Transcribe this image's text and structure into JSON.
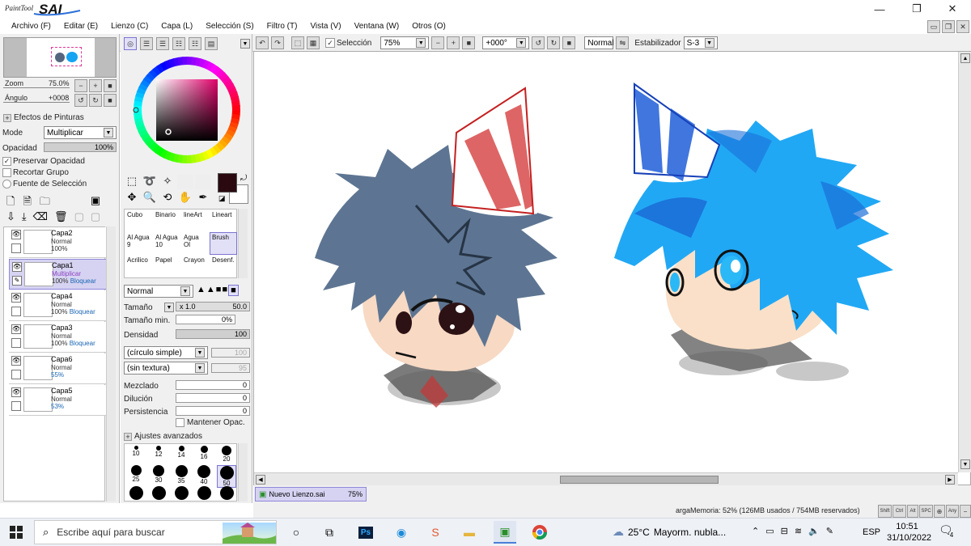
{
  "app": {
    "title_logo": "PaintTool SAI"
  },
  "menubar": [
    "Archivo (F)",
    "Editar (E)",
    "Lienzo (C)",
    "Capa (L)",
    "Selección (S)",
    "Filtro (T)",
    "Vista (V)",
    "Ventana (W)",
    "Otros (O)"
  ],
  "toolbar": {
    "selection_label": "Selección",
    "zoom_value": "75%",
    "angle_value": "+000°",
    "mode_value": "Normal",
    "stabilizer_label": "Estabilizador",
    "stabilizer_value": "S-3"
  },
  "navigator": {
    "zoom_label": "Zoom",
    "zoom_value": "75.0%",
    "angle_label": "Ángulo",
    "angle_value": "+0008"
  },
  "paint_effects": {
    "header": "Efectos de Pinturas",
    "mode_label": "Mode",
    "mode_value": "Multiplicar",
    "opacity_label": "Opacidad",
    "opacity_value": "100%",
    "preserve_opacity": "Preservar Opacidad",
    "clip_group": "Recortar Grupo",
    "selection_source": "Fuente de Selección"
  },
  "layers": [
    {
      "name": "Capa2",
      "mode": "Normal",
      "opacity": "100%",
      "lock": ""
    },
    {
      "name": "Capa1",
      "mode": "Multiplicar",
      "opacity": "100%",
      "lock": "Bloquear"
    },
    {
      "name": "Capa4",
      "mode": "Normal",
      "opacity": "100%",
      "lock": "Bloquear"
    },
    {
      "name": "Capa3",
      "mode": "Normal",
      "opacity": "100%",
      "lock": "Bloquear"
    },
    {
      "name": "Capa6",
      "mode": "Normal",
      "opacity": "55%",
      "lock": ""
    },
    {
      "name": "Capa5",
      "mode": "Normal",
      "opacity": "53%",
      "lock": ""
    }
  ],
  "brushes": [
    [
      "Cubo",
      "Binario",
      "lineArt",
      "Lineart"
    ],
    [
      "Al Agua 9",
      "Al Agua 10",
      "Agua Ol",
      "Brush"
    ],
    [
      "Acrilico",
      "Papel",
      "Crayon",
      "Desenf."
    ]
  ],
  "brush_settings": {
    "blend_mode": "Normal",
    "size_label": "Tamaño",
    "size_mult": "x 1.0",
    "size_value": "50.0",
    "min_size_label": "Tamaño min.",
    "min_size_value": "0%",
    "density_label": "Densidad",
    "density_value": "100",
    "shape": "(círculo simple)",
    "shape_value": "100",
    "texture": "(sin textura)",
    "texture_value": "95",
    "blend_label": "Mezclado",
    "blend_value": "0",
    "dilution_label": "Dilución",
    "dilution_value": "0",
    "persistence_label": "Persistencia",
    "persistence_value": "0",
    "keep_opacity": "Mantener Opac.",
    "advanced": "Ajustes avanzados"
  },
  "brush_sizes_row1": [
    "10",
    "12",
    "14",
    "16",
    "20"
  ],
  "brush_sizes_row2": [
    "25",
    "30",
    "35",
    "40",
    "50"
  ],
  "document_tab": {
    "name": "Nuevo Lienzo.sai",
    "zoom": "75%"
  },
  "status": {
    "memory": "argaMemoria: 52% (126MB usados / 754MB reservados)",
    "keys": [
      "Shift",
      "Ctrl",
      "Alt",
      "SPC"
    ],
    "any_label": "Any"
  },
  "taskbar": {
    "search_placeholder": "Escribe aquí para buscar",
    "weather_temp": "25°C",
    "weather_text": "Mayorm. nubla...",
    "lang": "ESP",
    "time": "10:51",
    "date": "31/10/2022",
    "notification_count": "4"
  },
  "colors": {
    "accent": "#7a74d0",
    "selected_layer": "#d6d3f2",
    "current_color": "#2a0a10",
    "lock_text": "#1a66b3"
  }
}
